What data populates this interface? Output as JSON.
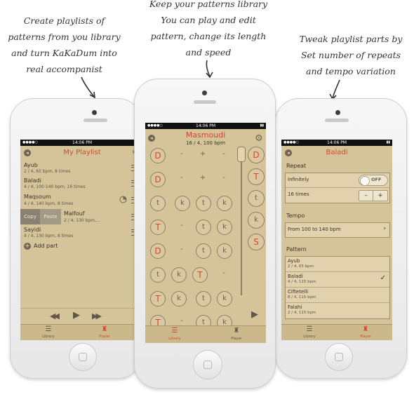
{
  "captions": {
    "left": [
      "Create playlists of",
      "patterns from you library",
      "and turn KaKaDum into",
      "real accompanist"
    ],
    "middle": [
      "Keep your patterns library",
      "You can play and edit",
      "pattern, change its length",
      "and speed"
    ],
    "right": [
      "Tweak playlist parts by",
      "Set number of repeats",
      "and tempo variation"
    ]
  },
  "status": {
    "time": "14:06 PM"
  },
  "tabs": {
    "library": "Library",
    "player": "Player"
  },
  "left_phone": {
    "title": "My Playlist",
    "items": [
      {
        "title": "Ayub",
        "sub": "2 / 4, 65 bpm, 8 times"
      },
      {
        "title": "Baladi",
        "sub": "4 / 4, 100-140 bpm, 16 times"
      },
      {
        "title": "Maqsoum",
        "sub": "4 / 4, 140 bpm, 8 times"
      },
      {
        "title": "Malfouf",
        "sub": "2 / 4, 130 bpm,..."
      },
      {
        "title": "Sayidi",
        "sub": "4 / 4, 130 bpm, 8 times"
      }
    ],
    "swipe": {
      "copy": "Copy",
      "paste": "Paste"
    },
    "add_part": "Add part"
  },
  "middle_phone": {
    "title": "Masmoudi",
    "subtitle": "16 / 4, 100 bpm",
    "grid": [
      [
        "D",
        "-",
        "+",
        "-"
      ],
      [
        "D",
        "-",
        "+",
        "-"
      ],
      [
        "t",
        "k",
        "t",
        "k"
      ],
      [
        "T",
        "-",
        "t",
        "k"
      ],
      [
        "D",
        "-",
        "t",
        "k"
      ],
      [
        "t",
        "k",
        "T",
        "-"
      ],
      [
        "T",
        "k",
        "t",
        "k"
      ],
      [
        "T",
        "-",
        "t",
        "k"
      ]
    ],
    "palette": [
      "D",
      "T",
      "t",
      "k",
      "S"
    ]
  },
  "right_phone": {
    "title": "Baladi",
    "repeat_header": "Repeat",
    "infinitely_label": "Infinitely",
    "toggle_state": "OFF",
    "times_label": "16 times",
    "minus": "–",
    "plus": "+",
    "tempo_header": "Tempo",
    "tempo_value": "From 100 to 140 bpm",
    "pattern_header": "Pattern",
    "patterns": [
      {
        "title": "Ayub",
        "sub": "2 / 4, 65 bpm"
      },
      {
        "title": "Baladi",
        "sub": "4 / 4, 115 bpm"
      },
      {
        "title": "Ciftetelli",
        "sub": "8 / 4, 115 bpm"
      },
      {
        "title": "Falahi",
        "sub": "2 / 4, 115 bpm"
      }
    ]
  },
  "colors": {
    "accent": "#d5472b",
    "screen": "#d5c49a"
  }
}
